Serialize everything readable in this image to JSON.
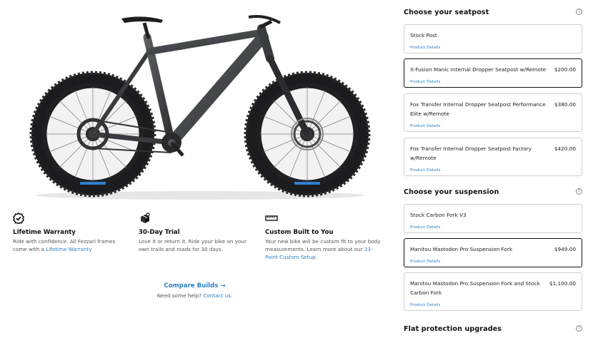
{
  "features": [
    {
      "icon": "check-badge-icon",
      "title": "Lifetime Warranty",
      "desc": "Ride with confidence. All Fezzari frames come with a ",
      "link": "Lifetime Warranty",
      "desc_after": ""
    },
    {
      "icon": "gift-box-icon",
      "title": "30-Day Trial",
      "desc": "Love it or return it. Ride your bike on your own trails and roads for 30 days.",
      "link": "",
      "desc_after": ""
    },
    {
      "icon": "ruler-icon",
      "title": "Custom Built to You",
      "desc": "Your new bike will be custom fit to your body measurements. Learn more about our ",
      "link": "23-Point Custom Setup",
      "desc_after": "."
    }
  ],
  "compare": {
    "label": "Compare Builds →",
    "help_text": "Need some help? ",
    "help_link": "Contact us."
  },
  "seatpost": {
    "title": "Choose your seatpost",
    "help_icon": "question-icon",
    "options": [
      {
        "name": "Stock Post",
        "price": "",
        "details": "Product Details",
        "selected": false
      },
      {
        "name": "X-Fusion Manic Internal Dropper Seatpost w/Remote",
        "price": "$200.00",
        "details": "Product Details",
        "selected": true
      },
      {
        "name": "Fox Transfer Internal Dropper Seatpost Performance Elite w/Remote",
        "price": "$380.00",
        "details": "Product Details",
        "selected": false
      },
      {
        "name": "Fox Transfer Internal Dropper Seatpost Factory w/Remote",
        "price": "$420.00",
        "details": "Product Details",
        "selected": false
      }
    ]
  },
  "suspension": {
    "title": "Choose your suspension",
    "help_icon": "question-icon",
    "options": [
      {
        "name": "Stock Carbon Fork V3",
        "price": "",
        "details": "Product Details",
        "selected": false
      },
      {
        "name": "Manitou Mastodon Pro Suspension Fork",
        "price": "$949.00",
        "details": "Product Details",
        "selected": true
      },
      {
        "name": "Manitou Mastodon Pro Suspension Fork and Stock Carbon Fork",
        "price": "$1,100.00",
        "details": "Product Details",
        "selected": false
      }
    ]
  },
  "flat_protection": {
    "title": "Flat protection upgrades",
    "help_icon": "question-icon"
  },
  "colors": {
    "accent": "#2e7fc5",
    "frame": "#4a4c50",
    "tire": "#1c1c1e",
    "rim_accent": "#2f7fd0"
  }
}
